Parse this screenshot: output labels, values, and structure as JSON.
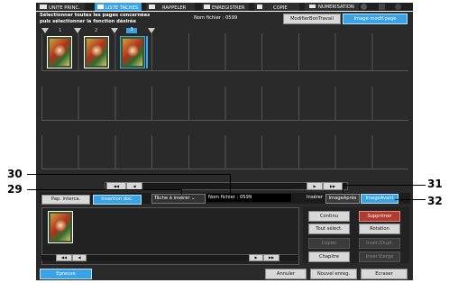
{
  "menu": {
    "items": [
      {
        "label": "UNITE PRINC."
      },
      {
        "label": "LISTE TACHES"
      },
      {
        "label": "RAPPELER"
      },
      {
        "label": "ENREGISTRER"
      },
      {
        "label": "COPIE"
      },
      {
        "label": "NUMERISATION"
      }
    ]
  },
  "header": {
    "line1": "Sélectionner toutes les pages concernées",
    "line2": "puis sélectionner la fonction désirée",
    "file_label": "Nom fichier : 0599",
    "tab_modify": "ModifierBonTravail",
    "tab_image": "Image modif.page"
  },
  "grid": {
    "page_numbers": [
      "1",
      "2",
      "3"
    ],
    "nav_first": "◀◀",
    "nav_prev": "◀",
    "nav_next": "▶",
    "nav_last": "▶▶"
  },
  "bottom": {
    "tab_pap": "Pap. interca.",
    "tab_insert": "Insertion doc.",
    "task_label": "Tâche à insérer",
    "file_name": "Nom fichier : 0599",
    "insert_label": "Insérer",
    "btn_image_after": "ImageAprès",
    "btn_image_before": "ImageAvant",
    "btn_continue": "Continu",
    "btn_delete": "Supprimer",
    "btn_select_all": "Tout sélect.",
    "btn_rotation": "Rotation",
    "btn_copy": "Copier",
    "btn_insert_dupl": "Insér.(Dupl.",
    "btn_chapter": "Chapitre",
    "btn_insert_blank": "Insér.Vierge",
    "btn_proof": "Epreuve",
    "btn_cancel": "Annuler",
    "btn_new_save": "Nouvel enreg.",
    "btn_overwrite": "Ecraser"
  },
  "callouts": [
    "30",
    "29",
    "31",
    "32"
  ],
  "colors": {
    "accent_blue": "#3aa3e6",
    "delete_red": "#b33a2e",
    "panel_dark": "#2a2a2a"
  }
}
